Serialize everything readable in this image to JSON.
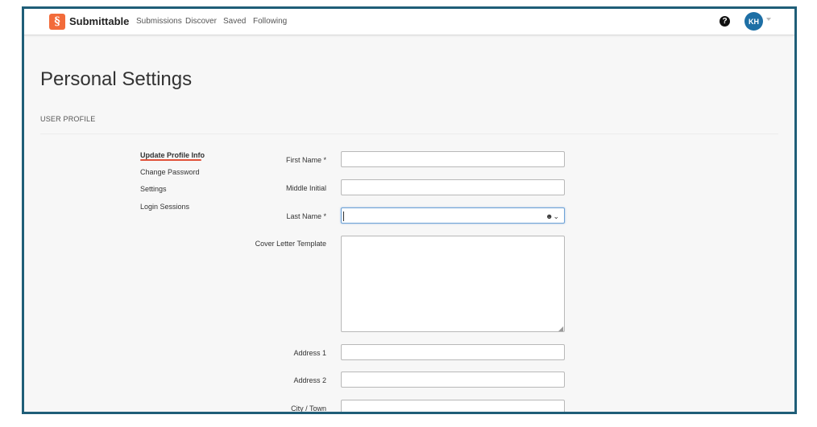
{
  "nav": {
    "brand": "Submittable",
    "links": [
      "Submissions",
      "Discover",
      "Saved",
      "Following"
    ],
    "help_symbol": "?",
    "avatar_initials": "KH"
  },
  "page": {
    "title": "Personal Settings",
    "section": "USER PROFILE"
  },
  "sidebar": {
    "items": [
      {
        "label": "Update Profile Info",
        "active": true
      },
      {
        "label": "Change Password",
        "active": false
      },
      {
        "label": "Settings",
        "active": false
      },
      {
        "label": "Login Sessions",
        "active": false
      }
    ]
  },
  "form": {
    "first_name": {
      "label": "First Name *",
      "value": ""
    },
    "middle_initial": {
      "label": "Middle Initial",
      "value": ""
    },
    "last_name": {
      "label": "Last Name *",
      "value": ""
    },
    "cover_letter": {
      "label": "Cover Letter Template",
      "value": ""
    },
    "address1": {
      "label": "Address 1",
      "value": ""
    },
    "address2": {
      "label": "Address 2",
      "value": ""
    },
    "city": {
      "label": "City / Town",
      "value": ""
    }
  },
  "icons": {
    "logo": "submittable-logo-icon",
    "help": "help-icon",
    "autofill": "contact-autofill-icon"
  },
  "colors": {
    "frame_border": "#1f5e78",
    "brand_orange": "#f26b3a",
    "avatar_blue": "#1d6fa5",
    "active_underline": "#e0523a",
    "focus_border": "#6fa3d6"
  }
}
